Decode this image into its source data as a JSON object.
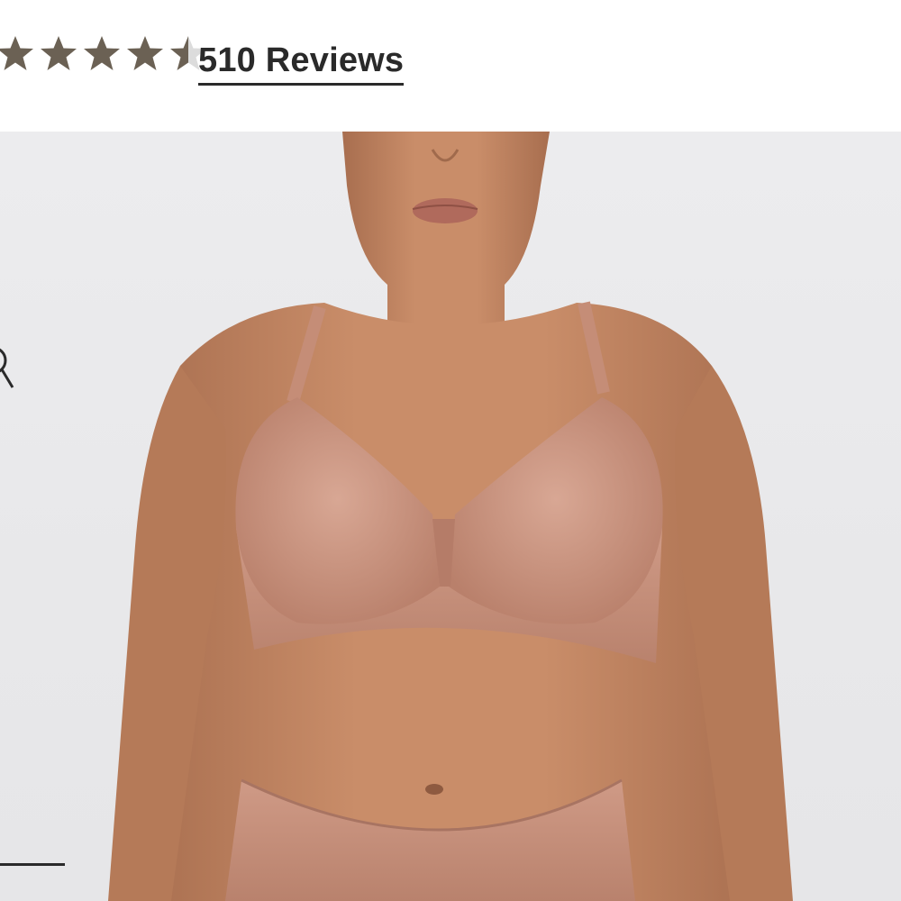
{
  "rating": {
    "value": 4.5,
    "max": 5,
    "star_color": "#6b6154",
    "star_empty_color": "#dcdcdc"
  },
  "reviews": {
    "label": "510 Reviews"
  },
  "product_image": {
    "background": "#ececee",
    "skin_color": "#c68a66",
    "garment_color": "#c9907c"
  },
  "icons": {
    "zoom": "magnifier-icon",
    "carousel": "carousel-indicator"
  }
}
